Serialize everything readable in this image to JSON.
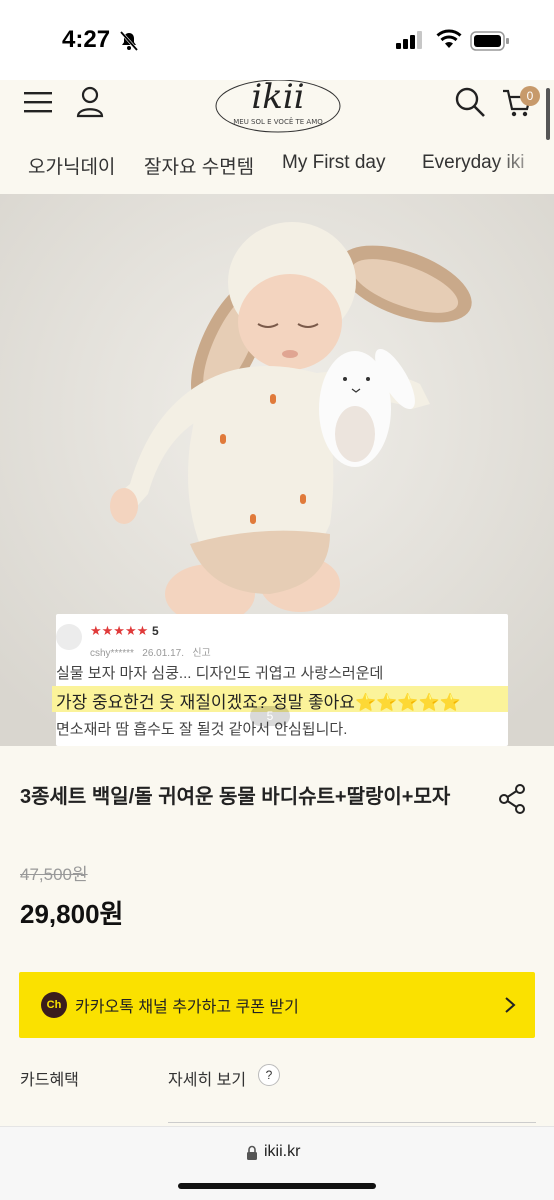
{
  "status_bar": {
    "time": "4:27",
    "icons": [
      "bell-slash-icon",
      "cellular-signal-icon",
      "wifi-icon",
      "battery-icon"
    ]
  },
  "header": {
    "logo_text": "ikii",
    "logo_subtext": "MEU SOL E VOCÊ TE AMO",
    "cart_count": "0"
  },
  "nav": {
    "items": [
      "오가닉데이",
      "잘자요 수면템",
      "My First day",
      "Everyday iki"
    ]
  },
  "hero": {
    "review": {
      "rating": "5",
      "user": "cshy******",
      "date": "26.01.17.",
      "report": "신고",
      "line1": "실물 보자 마자 심쿵... 디자인도 귀엽고 사랑스러운데",
      "line2": "가장 중요한건 옷 재질이겠죠? 정말 좋아요⭐⭐⭐⭐⭐",
      "line3": "면소재라 땀 흡수도 잘 될것 같아서 안심됩니다."
    },
    "slide_indicator": "5"
  },
  "product": {
    "title": "3종세트 백일/돌 귀여운 동물 바디슈트+딸랑이+모자",
    "original_price": "47,500원",
    "price": "29,800원"
  },
  "kakao": {
    "icon_label": "Ch",
    "label": "카카오톡 채널 추가하고 쿠폰 받기"
  },
  "card_benefit": {
    "label": "카드혜택",
    "detail": "자세히 보기",
    "help": "?"
  },
  "browser": {
    "url": "ikii.kr"
  },
  "colors": {
    "background": "#faf8f0",
    "kakao_yellow": "#fae100",
    "highlight": "#fbf39a",
    "star_red": "#e03a3a",
    "badge": "#c79a6b"
  }
}
